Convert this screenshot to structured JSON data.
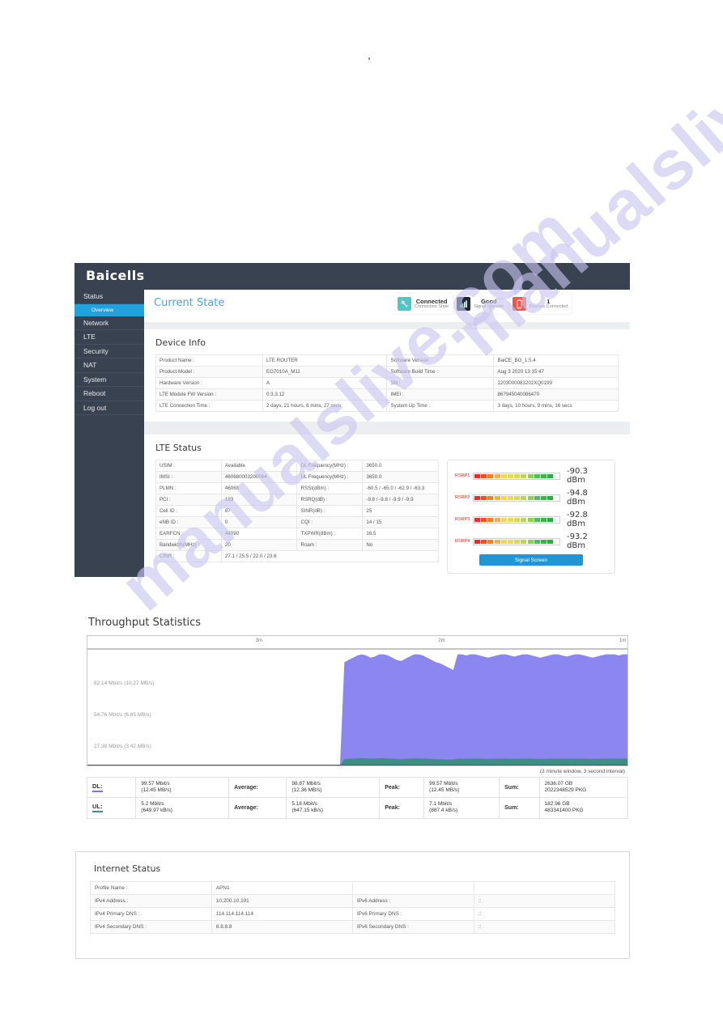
{
  "watermark": {
    "line1": "manualslive.com",
    "line2": "manualslive.com"
  },
  "header": {
    "logo": "Baicells"
  },
  "sidebar": {
    "items": [
      {
        "label": "Status",
        "active": false
      },
      {
        "label": "Overview",
        "active": true
      },
      {
        "label": "Network",
        "active": false
      },
      {
        "label": "LTE",
        "active": false
      },
      {
        "label": "Security",
        "active": false
      },
      {
        "label": "NAT",
        "active": false
      },
      {
        "label": "System",
        "active": false
      },
      {
        "label": "Reboot",
        "active": false
      },
      {
        "label": "Log out",
        "active": false
      }
    ]
  },
  "current_state": {
    "title": "Current State",
    "badges": [
      {
        "value": "Connected",
        "label": "Connection State",
        "icon": "connection-icon",
        "color": "#4ec8c6"
      },
      {
        "value": "Good",
        "label": "Signal Intensity",
        "icon": "signal-bars-icon",
        "color": "#1d2835"
      },
      {
        "value": "1",
        "label": "Devices Connected",
        "icon": "device-icon",
        "color": "#f4524d"
      }
    ]
  },
  "device_info": {
    "title": "Device Info",
    "rows": [
      {
        "k1": "Product Name :",
        "v1": "LTE ROUTER",
        "k2": "Software Version :",
        "v2": "BaiCE_BG_1.5.4"
      },
      {
        "k1": "Product Model :",
        "v1": "EG7010A_M11",
        "k2": "Software Build Time :",
        "v2": "Aug 3 2020 13:15:47"
      },
      {
        "k1": "Hardware Version :",
        "v1": "A",
        "k2": "SN :",
        "v2": "1203000083202XQ0199"
      },
      {
        "k1": "LTE Module FW Version :",
        "v1": "0.3.3.12",
        "k2": "IMEI :",
        "v2": "867945040086470"
      },
      {
        "k1": "LTE Connection Time :",
        "v1": "2 days, 21 hours, 6 mins, 27 secs",
        "k2": "System Up Time :",
        "v2": "3 days, 10 hours, 9 mins, 16 secs"
      }
    ]
  },
  "lte_status": {
    "title": "LTE Status",
    "rows": [
      {
        "k1": "USIM :",
        "v1": "Available",
        "k2": "DL Frequency(MHz) :",
        "v2": "3650.0"
      },
      {
        "k1": "IMSI :",
        "v1": "460680003200064",
        "k2": "UL Frequency(MHz) :",
        "v2": "3650.0"
      },
      {
        "k1": "PLMN :",
        "v1": "46068",
        "k2": "RSSI(dBm) :",
        "v2": "-60.5 / -65.0 / -62.9 / -63.3"
      },
      {
        "k1": "PCI :",
        "v1": "183",
        "k2": "RSRQ(dB) :",
        "v2": "-9.8 / -9.8 / -9.9 / -9.9"
      },
      {
        "k1": "Cell ID :",
        "v1": "87",
        "k2": "SINR(dB) :",
        "v2": "25"
      },
      {
        "k1": "eNB ID :",
        "v1": "0",
        "k2": "CQI :",
        "v2": "14 / 15"
      },
      {
        "k1": "EARFCN :",
        "v1": "44090",
        "k2": "TXPWR(dBm) :",
        "v2": "16.5"
      },
      {
        "k1": "Bandwidth(MHz) :",
        "v1": "20",
        "k2": "Roam :",
        "v2": "No"
      },
      {
        "k1": "CINR :",
        "v1": "27.1 / 25.5 / 22.0 / 23.6",
        "k2": "",
        "v2": ""
      }
    ],
    "rsrp": [
      {
        "label": "RSRP1",
        "value": "-90.3 dBm",
        "filled": 10
      },
      {
        "label": "RSRP2",
        "value": "-94.8 dBm",
        "filled": 10
      },
      {
        "label": "RSRP3",
        "value": "-92.8 dBm",
        "filled": 10
      },
      {
        "label": "RSRP4",
        "value": "-93.2 dBm",
        "filled": 10
      }
    ],
    "signal_button": "Signal Screen"
  },
  "throughput": {
    "title": "Throughput Statistics",
    "note": "(3 minute window, 3 second interval)",
    "rows": [
      {
        "dir": "DL:",
        "current": "99.57 Mbit/s",
        "current_sub": "(12.45 MB/s)",
        "average_label": "Average:",
        "average": "98.87 Mbit/s",
        "average_sub": "(12.36 MB/s)",
        "peak_label": "Peak:",
        "peak": "99.57 Mbit/s",
        "peak_sub": "(12.45 MB/s)",
        "sum_label": "Sum:",
        "sum": "2636.07 GB",
        "sum_sub": "2022348529 PKG"
      },
      {
        "dir": "UL:",
        "current": "5.2 Mbit/s",
        "current_sub": "(649.97 kB/s)",
        "average_label": "Average:",
        "average": "5.18 Mbit/s",
        "average_sub": "(647.15 kB/s)",
        "peak_label": "Peak:",
        "peak": "7.1 Mbit/s",
        "peak_sub": "(887.4 kB/s)",
        "sum_label": "Sum:",
        "sum": "182.96 GB",
        "sum_sub": "483341400 PKG"
      }
    ]
  },
  "chart_data": {
    "type": "area",
    "title": "Throughput Statistics",
    "xlabel": "",
    "ylabel": "",
    "xticks": [
      "3m",
      "2m",
      "1m"
    ],
    "yticks": [
      "82.14 Mbit/s (10.27 MB/s)",
      "54.76 Mbit/s (6.85 MB/s)",
      "27.38 Mbit/s (3.42 MB/s)"
    ],
    "ylim": [
      0,
      109.52
    ],
    "grid": false,
    "legend": "none",
    "annotation": "(3 minute window, 3 second interval)",
    "series": [
      {
        "name": "DL",
        "color": "#8c86f0",
        "values": [
          0,
          0,
          0,
          0,
          0,
          0,
          0,
          0,
          0,
          0,
          0,
          0,
          0,
          0,
          0,
          0,
          0,
          0,
          0,
          0,
          0,
          0,
          0,
          0,
          0,
          0,
          0,
          0,
          0,
          0,
          0,
          0,
          0,
          0,
          0,
          0,
          0,
          0,
          0,
          0,
          0,
          0,
          0,
          0,
          0,
          0,
          0,
          0,
          0,
          0,
          0,
          0,
          0,
          0,
          0,
          0,
          0,
          0,
          0,
          92,
          94,
          96,
          98,
          99,
          98,
          96,
          97,
          99,
          99,
          98,
          96,
          94,
          93,
          95,
          97,
          99,
          99,
          98,
          96,
          94,
          92,
          91,
          89,
          87,
          85,
          99,
          99,
          98,
          99,
          99,
          98,
          97,
          96,
          97,
          98,
          99,
          99,
          98,
          97,
          98,
          99,
          99,
          98,
          97,
          96,
          97,
          98,
          99,
          99,
          98,
          97,
          98,
          99,
          99,
          98,
          97,
          96,
          97,
          98,
          99,
          99,
          99,
          98,
          99,
          99
        ]
      },
      {
        "name": "UL",
        "color": "#3e8e84",
        "values": [
          0,
          0,
          0,
          0,
          0,
          0,
          0,
          0,
          0,
          0,
          0,
          0,
          0,
          0,
          0,
          0,
          0,
          0,
          0,
          0,
          0,
          0,
          0,
          0,
          0,
          0,
          0,
          0,
          0,
          0,
          0,
          0,
          0,
          0,
          0,
          0,
          0,
          0,
          0,
          0,
          0,
          0,
          0,
          0,
          0,
          0,
          0,
          0,
          0,
          0,
          0,
          0,
          0,
          0,
          0,
          0,
          0,
          0,
          0,
          5.8,
          6.0,
          6.2,
          6.4,
          6.5,
          6.3,
          6.1,
          6.2,
          6.4,
          6.4,
          6.2,
          6.0,
          5.8,
          5.7,
          5.9,
          6.1,
          6.3,
          6.3,
          6.2,
          6.0,
          5.8,
          5.7,
          5.6,
          5.4,
          5.3,
          5.2,
          6.0,
          6.1,
          6.0,
          6.1,
          6.2,
          6.0,
          5.9,
          5.8,
          5.9,
          6.0,
          6.1,
          6.1,
          6.0,
          5.9,
          6.0,
          6.1,
          6.1,
          6.0,
          5.9,
          5.8,
          5.9,
          6.0,
          6.1,
          6.1,
          6.0,
          5.9,
          6.0,
          6.1,
          6.1,
          6.0,
          5.9,
          5.8,
          5.9,
          6.0,
          6.1,
          6.1,
          6.1,
          6.0,
          6.1,
          6.1
        ]
      }
    ]
  },
  "internet_status": {
    "title": "Internet Status",
    "rows": [
      {
        "k1": "Profile Name :",
        "v1": "APN1",
        "k2": "",
        "v2": ""
      },
      {
        "k1": "IPv4 Address :",
        "v1": "10.200.10.191",
        "k2": "IPv6 Address :",
        "v2": "::"
      },
      {
        "k1": "IPv4 Primary DNS :",
        "v1": "114.114.114.114",
        "k2": "IPv6 Primary DNS :",
        "v2": "::"
      },
      {
        "k1": "IPv4 Secondary DNS :",
        "v1": "8.8.8.8",
        "k2": "IPv6 Secondary DNS :",
        "v2": "::"
      }
    ]
  }
}
